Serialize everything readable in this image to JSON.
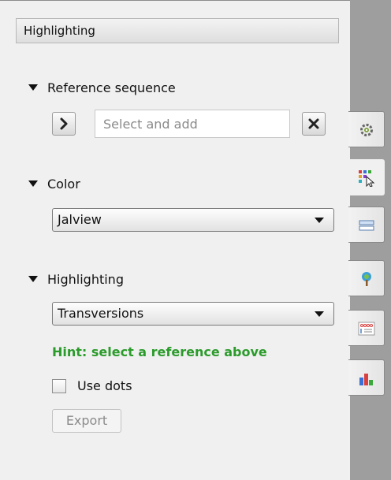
{
  "panel": {
    "header": "Highlighting"
  },
  "reference_sequence": {
    "title": "Reference sequence",
    "placeholder": "Select and add",
    "add_icon": "chevron-right-icon",
    "clear_icon": "close-icon"
  },
  "color": {
    "title": "Color",
    "selected": "Jalview"
  },
  "highlighting": {
    "title": "Highlighting",
    "selected": "Transversions",
    "hint": "Hint: select a reference above",
    "use_dots_label": "Use dots",
    "use_dots_checked": false,
    "export_label": "Export"
  },
  "side_tabs": [
    {
      "icon": "settings-icon"
    },
    {
      "icon": "color-picker-icon",
      "active": true
    },
    {
      "icon": "layout-icon"
    },
    {
      "icon": "tree-icon"
    },
    {
      "icon": "matrix-icon"
    },
    {
      "icon": "bar-chart-icon"
    }
  ],
  "colors": {
    "hint_text": "#2b9b2b",
    "sidebar_strip": "#9e9e9e"
  }
}
